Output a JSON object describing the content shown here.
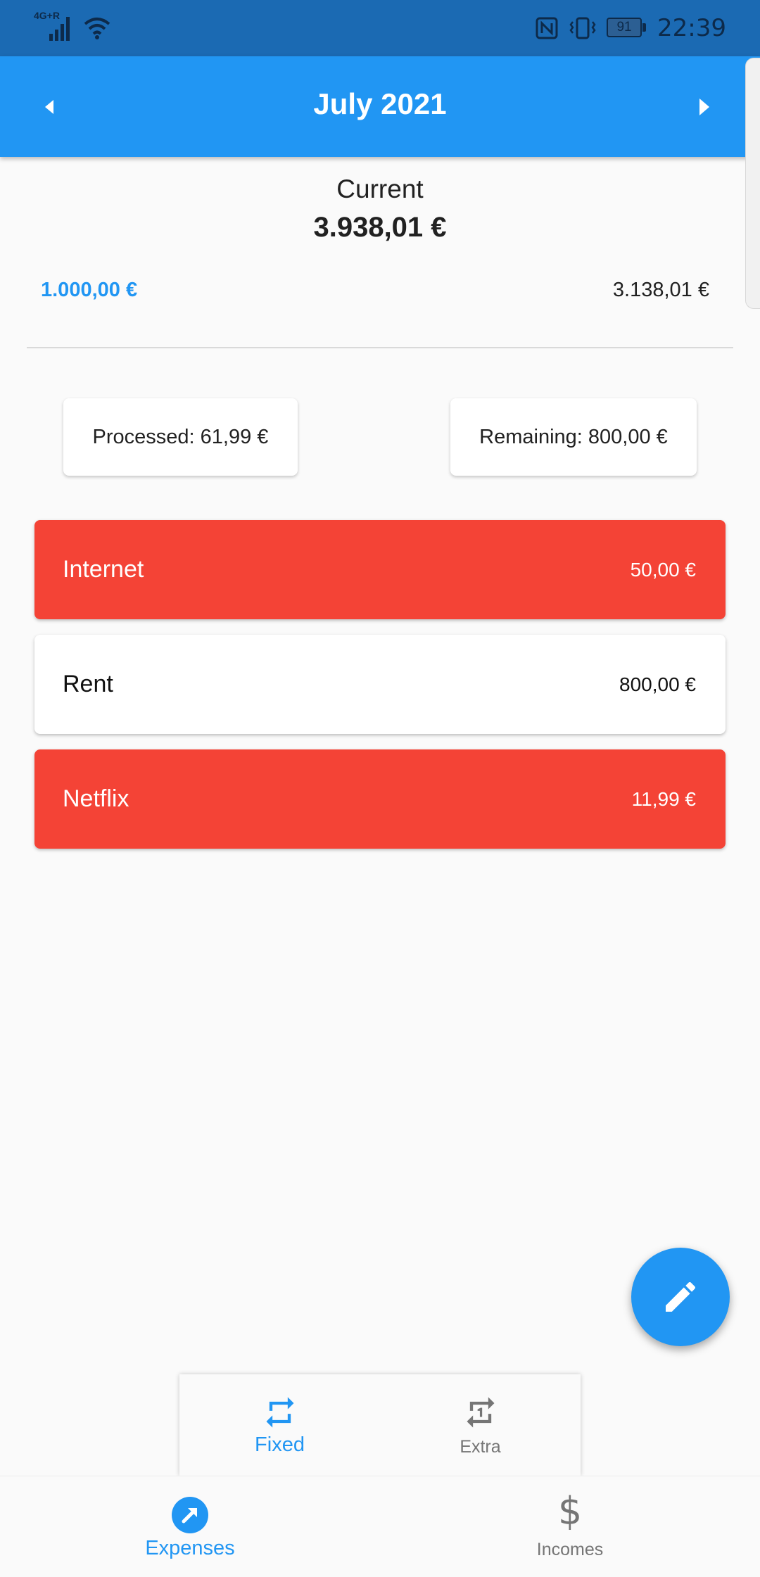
{
  "status_bar": {
    "network_label": "4G+R",
    "battery_level": "91",
    "time": "22:39"
  },
  "header": {
    "title": "July 2021",
    "prev_icon": "arrow-left-icon",
    "next_icon": "arrow-right-icon"
  },
  "balance": {
    "label": "Current",
    "current": "3.938,01 €",
    "incomes": "1.000,00 €",
    "expenses": "3.138,01 €"
  },
  "summary": {
    "processed": "Processed: 61,99 €",
    "remaining": "Remaining: 800,00 €"
  },
  "expenses": [
    {
      "name": "Internet",
      "amount": "50,00 €",
      "status": "unpaid",
      "color": "#f44336"
    },
    {
      "name": "Rent",
      "amount": "800,00 €",
      "status": "paid",
      "color": "#ffffff"
    },
    {
      "name": "Netflix",
      "amount": "11,99 €",
      "status": "unpaid",
      "color": "#f44336"
    }
  ],
  "fab": {
    "icon": "pencil-icon"
  },
  "sub_tabs": [
    {
      "label": "Fixed",
      "icon": "repeat-icon",
      "active": true
    },
    {
      "label": "Extra",
      "icon": "repeat-one-icon",
      "active": false
    }
  ],
  "bottom_nav": [
    {
      "label": "Expenses",
      "icon": "arrow-up-right-circle-icon",
      "active": true
    },
    {
      "label": "Incomes",
      "icon": "dollar-icon",
      "active": false
    }
  ],
  "colors": {
    "primary": "#2196f3",
    "status_bar": "#1b6ab3",
    "unpaid": "#f44336",
    "background": "#fafafa"
  }
}
